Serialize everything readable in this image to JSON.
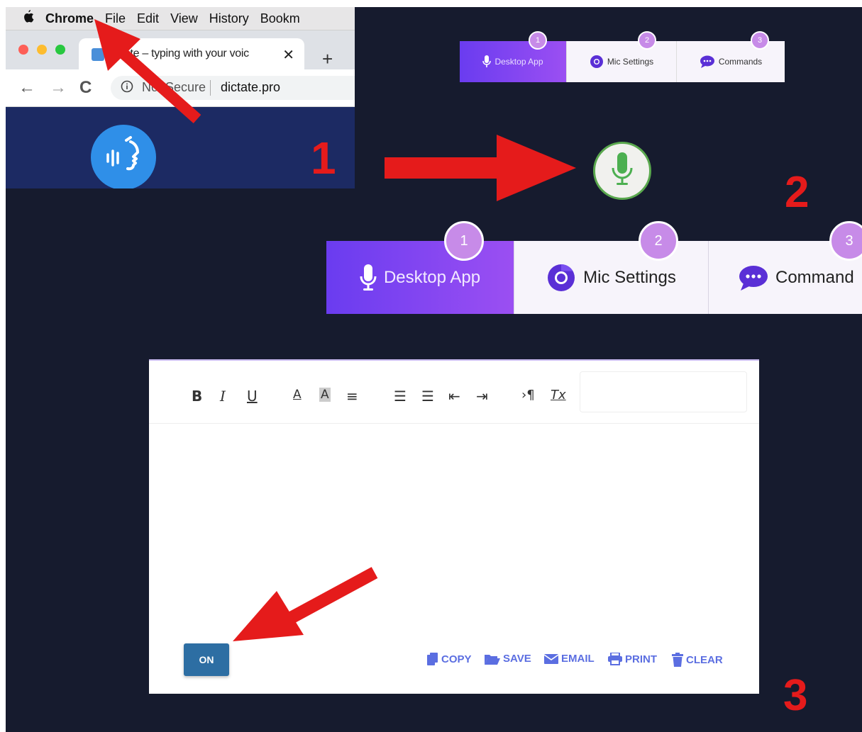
{
  "browser": {
    "menubar": {
      "apple": "",
      "app_name": "Chrome",
      "items": [
        "File",
        "Edit",
        "View",
        "History",
        "Bookm"
      ]
    },
    "tab": {
      "title": "…tate – typing with your voic",
      "close": "✕"
    },
    "new_tab": "+",
    "nav": {
      "back": "←",
      "forward": "→",
      "reload": "C"
    },
    "address": {
      "security": "Not Secure",
      "url": "dictate.pro"
    }
  },
  "steps": [
    "1",
    "2",
    "3"
  ],
  "small_tabs": [
    {
      "badge": "1",
      "label": "Desktop App",
      "icon": "microphone-icon"
    },
    {
      "badge": "2",
      "label": "Mic Settings",
      "icon": "chrome-icon"
    },
    {
      "badge": "3",
      "label": "Commands",
      "icon": "chat-icon"
    }
  ],
  "big_tabs": [
    {
      "badge": "1",
      "label": "Desktop App",
      "icon": "microphone-icon"
    },
    {
      "badge": "2",
      "label": "Mic Settings",
      "icon": "chrome-icon"
    },
    {
      "badge": "3",
      "label": "Command",
      "icon": "chat-icon"
    }
  ],
  "editor": {
    "toolbar": {
      "bold": "B",
      "italic": "I",
      "underline": "U",
      "font_color": "A",
      "highlight": "A",
      "align": "≡",
      "ordered_list": "☰",
      "bullet_list": "☰",
      "outdent": "⇤",
      "indent": "⇥",
      "paragraph": "›¶",
      "clear_format": "Tx"
    },
    "on_button": "ON",
    "actions": {
      "copy": "COPY",
      "save": "SAVE",
      "email": "EMAIL",
      "print": "PRINT",
      "clear": "CLEAR"
    }
  },
  "colors": {
    "background": "#161b2e",
    "accent_purple": "#7b44f1",
    "badge": "#c78be8",
    "arrow_red": "#e51b1b",
    "mic_green": "#4caf50",
    "on_button": "#2d6ea3",
    "action_blue": "#5b6ee1"
  }
}
